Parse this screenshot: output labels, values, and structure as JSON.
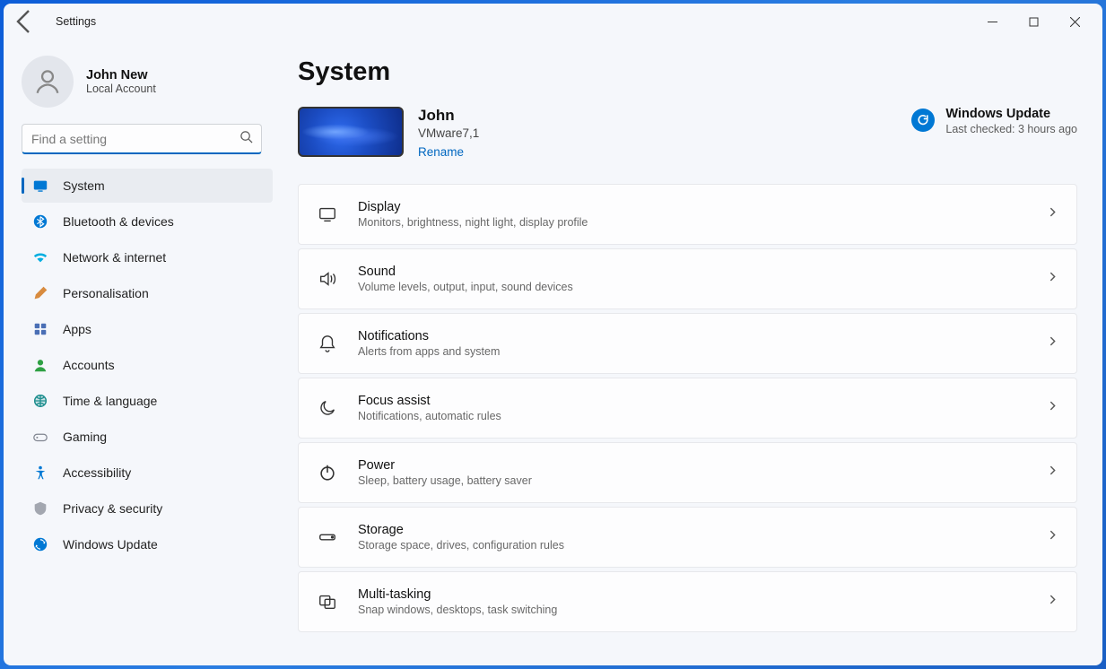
{
  "app_title": "Settings",
  "profile": {
    "name": "John New",
    "sub": "Local Account"
  },
  "search": {
    "placeholder": "Find a setting",
    "value": ""
  },
  "sidebar": {
    "items": [
      {
        "label": "System",
        "selected": true
      },
      {
        "label": "Bluetooth & devices"
      },
      {
        "label": "Network & internet"
      },
      {
        "label": "Personalisation"
      },
      {
        "label": "Apps"
      },
      {
        "label": "Accounts"
      },
      {
        "label": "Time & language"
      },
      {
        "label": "Gaming"
      },
      {
        "label": "Accessibility"
      },
      {
        "label": "Privacy & security"
      },
      {
        "label": "Windows Update"
      }
    ]
  },
  "page": {
    "title": "System",
    "device": {
      "name": "John",
      "model": "VMware7,1",
      "rename": "Rename"
    },
    "update": {
      "title": "Windows Update",
      "sub": "Last checked: 3 hours ago"
    },
    "cards": [
      {
        "title": "Display",
        "sub": "Monitors, brightness, night light, display profile"
      },
      {
        "title": "Sound",
        "sub": "Volume levels, output, input, sound devices"
      },
      {
        "title": "Notifications",
        "sub": "Alerts from apps and system"
      },
      {
        "title": "Focus assist",
        "sub": "Notifications, automatic rules"
      },
      {
        "title": "Power",
        "sub": "Sleep, battery usage, battery saver"
      },
      {
        "title": "Storage",
        "sub": "Storage space, drives, configuration rules"
      },
      {
        "title": "Multi-tasking",
        "sub": "Snap windows, desktops, task switching"
      }
    ]
  }
}
